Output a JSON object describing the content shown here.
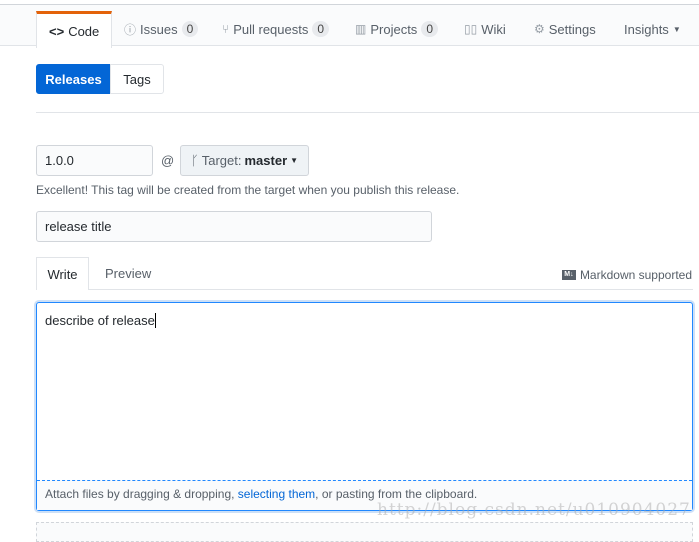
{
  "nav": {
    "tabs": [
      {
        "label": "Code",
        "icon": "code-icon"
      },
      {
        "label": "Issues",
        "count": "0",
        "icon": "issue-icon"
      },
      {
        "label": "Pull requests",
        "count": "0",
        "icon": "pull-request-icon"
      },
      {
        "label": "Projects",
        "count": "0",
        "icon": "project-icon"
      },
      {
        "label": "Wiki",
        "icon": "book-icon"
      },
      {
        "label": "Settings",
        "icon": "gear-icon"
      },
      {
        "label": "Insights",
        "icon": "caret-down-icon"
      }
    ]
  },
  "subnav": {
    "releases": "Releases",
    "tags": "Tags"
  },
  "form": {
    "tag": "1.0.0",
    "at": "@",
    "target_label": "Target:",
    "target_branch": "master",
    "help": "Excellent! This tag will be created from the target when you publish this release.",
    "title": "release title"
  },
  "editor": {
    "write": "Write",
    "preview": "Preview",
    "markdown": "Markdown supported",
    "body": "describe of release",
    "attach_pre": "Attach files by dragging & dropping, ",
    "attach_link": "selecting them",
    "attach_post": ", or pasting from the clipboard."
  },
  "watermark": "http://blog.csdn.net/u010904027",
  "colors": {
    "accent": "#0366d6",
    "tab_top": "#e36209"
  }
}
